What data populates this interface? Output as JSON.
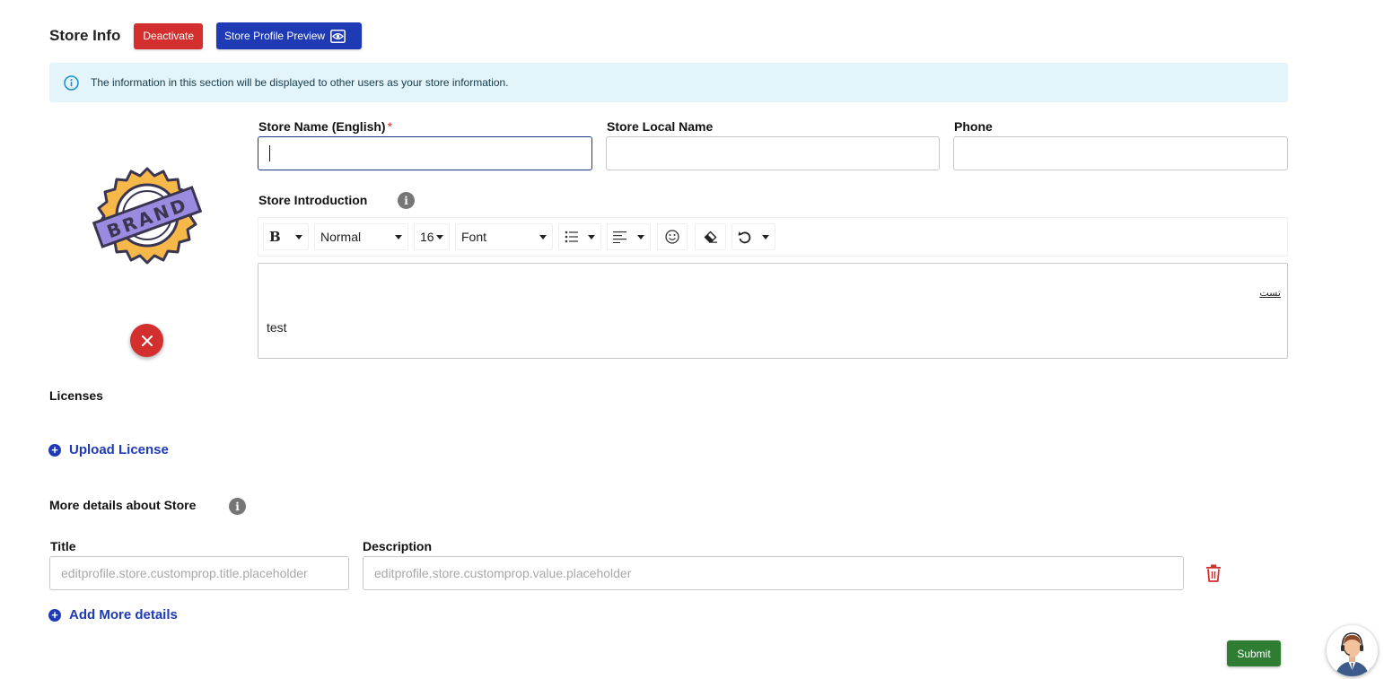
{
  "header": {
    "title": "Store Info",
    "deactivate_label": "Deactivate",
    "preview_label": "Store Profile Preview"
  },
  "info_banner": {
    "text": "The information in this section will be displayed to other users as your store information."
  },
  "logo": {
    "text": "BRAND"
  },
  "fields": {
    "store_name_label": "Store Name (English)",
    "required_mark": "*",
    "store_name_value": "",
    "local_name_label": "Store Local Name",
    "local_name_value": "",
    "phone_label": "Phone",
    "phone_value": ""
  },
  "introduction": {
    "label": "Store Introduction",
    "toolbar": {
      "bold_label": "B",
      "block_type": "Normal",
      "font_size": "16",
      "font_family": "Font"
    },
    "content_rtl": "تست",
    "content_ltr": "test"
  },
  "licenses": {
    "title": "Licenses",
    "upload_label": "Upload License"
  },
  "more_details": {
    "title": "More details about Store",
    "title_col_label": "Title",
    "description_col_label": "Description",
    "title_placeholder": "editprofile.store.customprop.title.placeholder",
    "description_placeholder": "editprofile.store.customprop.value.placeholder",
    "add_label": "Add More details"
  },
  "submit_label": "Submit",
  "colors": {
    "danger": "#d32f2f",
    "primary": "#1e3ab5",
    "success": "#2e7d32",
    "info_bg": "#e3f4fb"
  }
}
